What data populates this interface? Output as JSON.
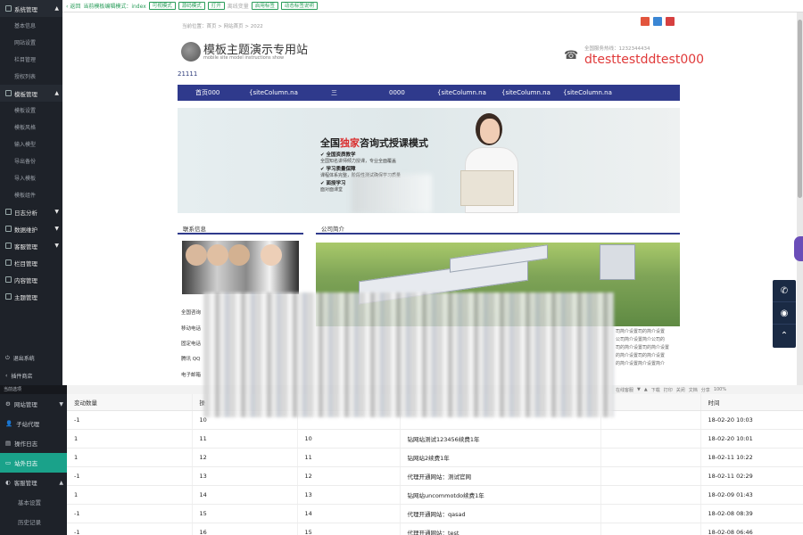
{
  "sidebar": {
    "groups": [
      {
        "label": "系统管理",
        "items": [
          "基本信息",
          "网站设置",
          "栏目管理",
          "授权列表"
        ]
      },
      {
        "label": "模板管理",
        "items": [
          "模板设置",
          "模板风格",
          "输入模型",
          "导出备份",
          "导入模板",
          "模板组件"
        ]
      },
      {
        "label": "日志分析"
      },
      {
        "label": "数据维护"
      },
      {
        "label": "客服管理"
      },
      {
        "label": "栏目管理"
      },
      {
        "label": "内容管理"
      },
      {
        "label": "主题管理"
      }
    ],
    "bottom": [
      "退出系统",
      "插件商店"
    ]
  },
  "topbar": {
    "back": "返回",
    "hint": "当前模板编辑模式：index",
    "buttons": [
      "可视模式",
      "源码模式",
      "打开"
    ],
    "gray": [
      "离线变量"
    ],
    "buttons2": [
      "启用标签",
      "动态标签说明"
    ]
  },
  "preview": {
    "breadcrumb": "当前位置：首页 > 网站首页 > 2022",
    "site_title": "模板主题演示专用站",
    "site_subtitle": "mobile site model instructions show",
    "tel_label": "全国服务热线：1232344434",
    "tel_number": "dtesttestddtest000",
    "number_line": "21111",
    "nav": [
      "首页000",
      "{siteColumn.na",
      "三",
      "0000",
      "{siteColumn.na",
      "{siteColumn.na",
      "{siteColumn.na"
    ],
    "banner": {
      "title_a": "全国",
      "title_red": "独家",
      "title_b": "咨询式授课模式",
      "points": [
        {
          "t": "✔ 全国资质教学",
          "d": "全国知名讲师倾力授课，专业全面覆盖"
        },
        {
          "t": "✔ 学习质量保障",
          "d": "课程体系完整，阶段性测试确保学习质量"
        },
        {
          "t": "✔ 面授学习",
          "d": "面对面课堂"
        }
      ]
    },
    "contact": {
      "heading": "联系信息",
      "lines": [
        "全国咨询",
        "移动电话",
        "固定电话",
        "腾讯 QQ",
        "电子邮箱"
      ]
    },
    "intro": {
      "heading": "公司简介",
      "lines": [
        "司简介设置司的简介设置",
        "公司简介设置简介公司的",
        "司的简介设置司的简介设置",
        "的简介设置司的简介设置",
        "的简介设置简介设置简介"
      ]
    }
  },
  "toolbar2": [
    "在线客服",
    "▼",
    "▲",
    "下载",
    "打印",
    "关闭",
    "文档",
    "分享",
    "100%"
  ],
  "sidebar2": {
    "header": "当前选项",
    "items": [
      {
        "label": "网站管理",
        "icon": "gear-icon"
      },
      {
        "label": "子站代理",
        "icon": "user-icon"
      },
      {
        "label": "操作日志",
        "icon": "doc-icon"
      },
      {
        "label": "站外日志",
        "icon": "monitor-icon",
        "active": true
      },
      {
        "label": "客服管理",
        "icon": "headset-icon"
      }
    ],
    "subitems": [
      "基本设置",
      "历史记录"
    ]
  },
  "table": {
    "columns": [
      "变动数量",
      "操",
      "",
      "",
      "",
      "时间"
    ],
    "rows": [
      [
        "-1",
        "10",
        "",
        "",
        "",
        "18-02-20 10:03"
      ],
      [
        "1",
        "11",
        "10",
        "钻网站测试123456续费1年",
        "",
        "18-02-20 10:01"
      ],
      [
        "1",
        "12",
        "11",
        "钻网站2续费1年",
        "",
        "18-02-11 10:22"
      ],
      [
        "-1",
        "13",
        "12",
        "代理开通网站：测试官网",
        "",
        "18-02-11 02:29"
      ],
      [
        "1",
        "14",
        "13",
        "钻网站uncommotdo续费1年",
        "",
        "18-02-09 01:43"
      ],
      [
        "-1",
        "15",
        "14",
        "代理开通网站：qasad",
        "",
        "18-02-08 08:39"
      ],
      [
        "-1",
        "16",
        "15",
        "代理开通网站：test",
        "",
        "18-02-08 06:46"
      ]
    ]
  },
  "colors": {
    "accent": "#2f3a8c",
    "teal": "#1aa28a",
    "red": "#e03a3a",
    "dark": "#1e2229"
  }
}
